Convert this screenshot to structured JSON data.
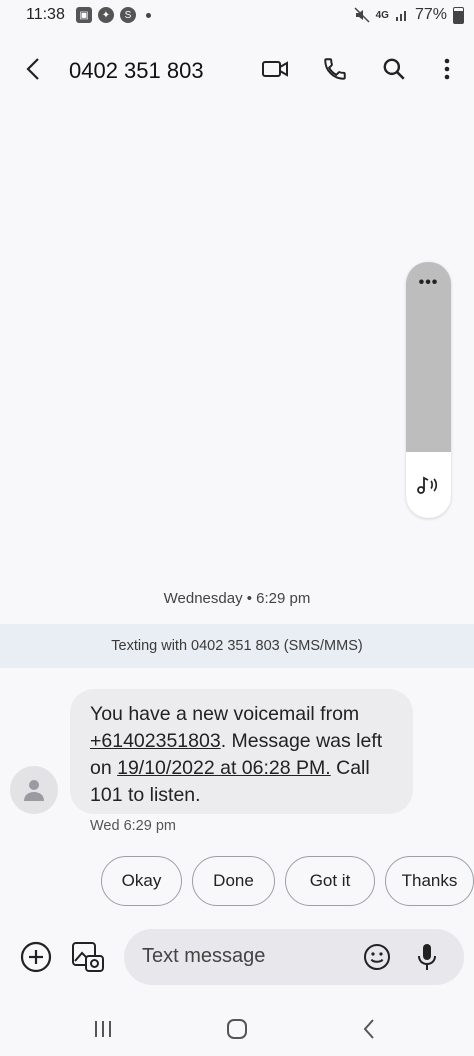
{
  "status_bar": {
    "time": "11:38",
    "network": "4G",
    "battery": "77%"
  },
  "header": {
    "contact": "0402 351 803"
  },
  "conversation": {
    "date_separator": "Wednesday • 6:29 pm",
    "texting_with": "Texting with 0402 351 803 (SMS/MMS)",
    "message": {
      "text_1": "You have a new voicemail from ",
      "link_phone": "+61402351803",
      "text_2": ". Message was left on ",
      "link_date": "19/10/2022 at 06:28 PM.",
      "text_3": " Call 101 to listen.",
      "timestamp": "Wed 6:29 pm"
    }
  },
  "smart_replies": [
    "Okay",
    "Done",
    "Got it",
    "Thanks"
  ],
  "composer": {
    "placeholder": "Text message"
  },
  "colors": {
    "background": "#f8f8fb",
    "bubble": "#ececef",
    "banner": "#e9eef4"
  }
}
